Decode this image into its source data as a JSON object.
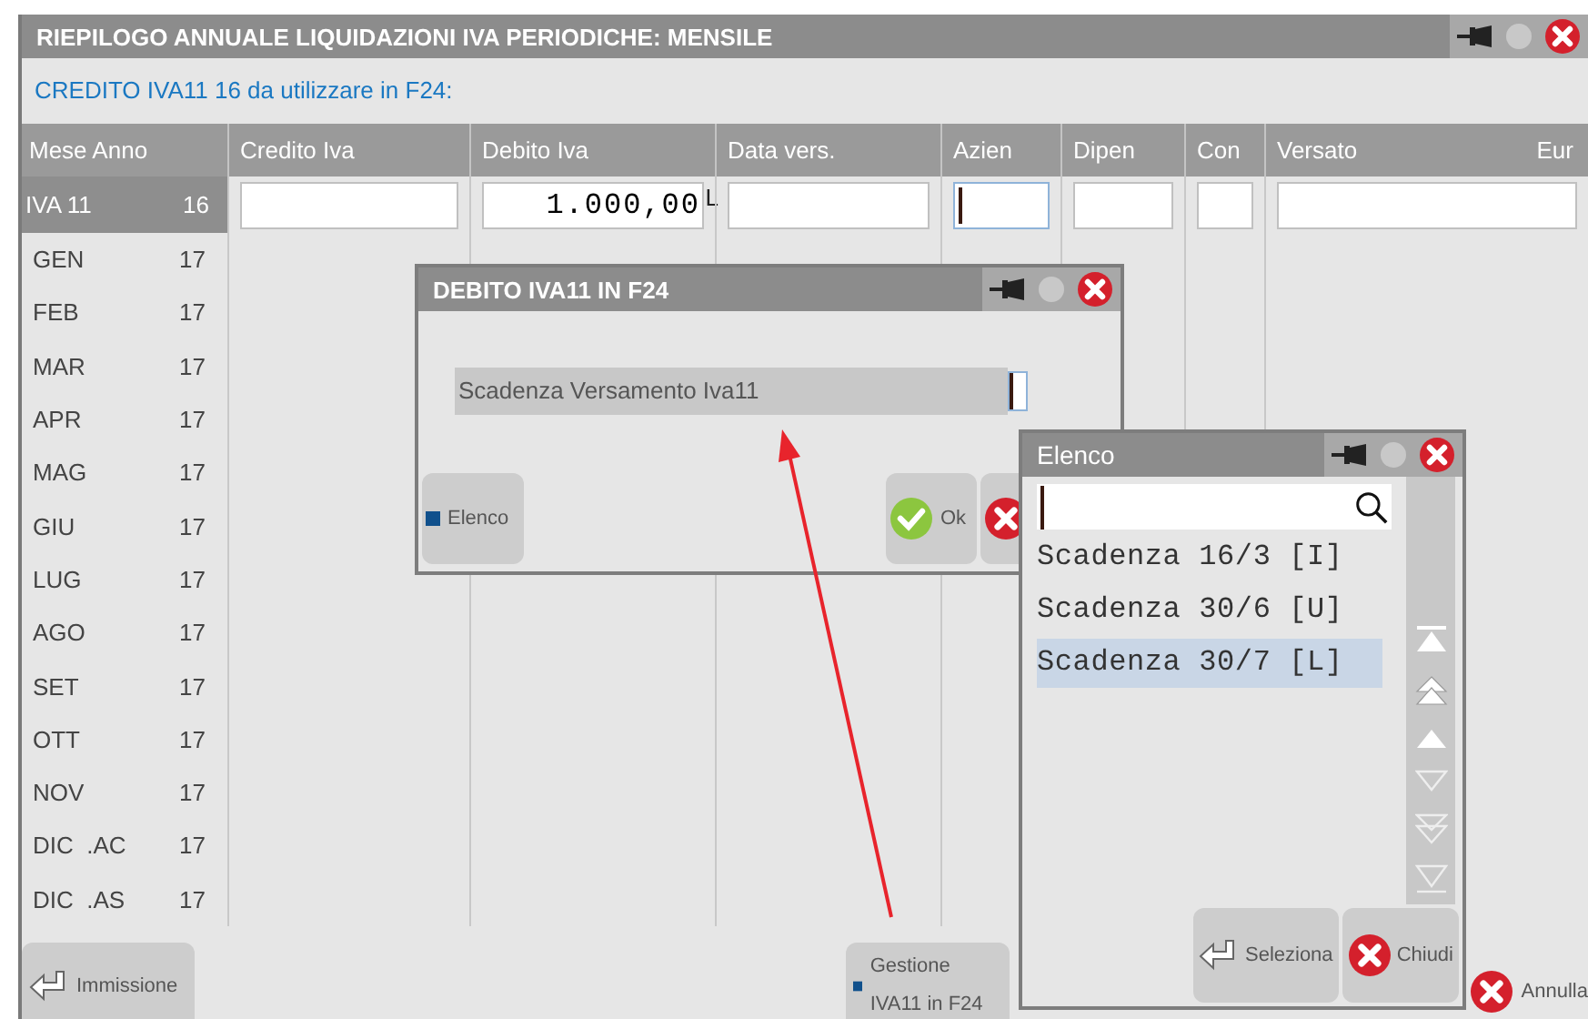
{
  "window": {
    "title": "RIEPILOGO ANNUALE LIQUIDAZIONI IVA PERIODICHE: MENSILE"
  },
  "subtitle": "CREDITO IVA11 16 da utilizzare in F24:",
  "table": {
    "columns": [
      "Mese Anno",
      "Credito Iva",
      "Debito  Iva",
      "Data vers.",
      "Azien",
      "Dipen",
      "Con",
      "Versato"
    ],
    "currency_label": "Eur",
    "entry_row": {
      "month": "IVA 11",
      "year": "16",
      "fields": [
        {
          "focused": false
        },
        {
          "focused": false,
          "value": "1.000,00",
          "suffix": "L"
        },
        {
          "focused": false
        },
        {
          "focused": true
        },
        {
          "focused": false
        },
        {
          "focused": false
        },
        {
          "focused": false
        }
      ]
    },
    "rows": [
      {
        "month": "GEN",
        "year": "17"
      },
      {
        "month": "FEB",
        "year": "17"
      },
      {
        "month": "MAR",
        "year": "17"
      },
      {
        "month": "APR",
        "year": "17"
      },
      {
        "month": "MAG",
        "year": "17"
      },
      {
        "month": "GIU",
        "year": "17"
      },
      {
        "month": "LUG",
        "year": "17"
      },
      {
        "month": "AGO",
        "year": "17"
      },
      {
        "month": "SET",
        "year": "17"
      },
      {
        "month": "OTT",
        "year": "17"
      },
      {
        "month": "NOV",
        "year": "17"
      },
      {
        "month": "DIC  .AC",
        "year": "17"
      },
      {
        "month": "DIC  .AS",
        "year": "17"
      }
    ]
  },
  "buttons": [
    {
      "label": "Immissione",
      "kind": "enter"
    },
    {
      "label": "Gestione IVA11 in F24",
      "kind": "square"
    },
    {
      "label": "Annulla",
      "kind": "cancel"
    }
  ],
  "dialog": {
    "title": "DEBITO IVA11 IN F24",
    "field": {
      "label": "Scadenza Versamento Iva11",
      "focused": true
    },
    "buttons": [
      {
        "label": "Elenco",
        "kind": "square"
      },
      {
        "label": "Ok",
        "kind": "check"
      },
      {
        "kind": "cancel"
      }
    ]
  },
  "list_popup": {
    "title": "Elenco",
    "search": {
      "focused": true
    },
    "items": [
      {
        "label": "Scadenza 16/3 [I]",
        "selected": false
      },
      {
        "label": "Scadenza 30/6 [U]",
        "selected": false
      },
      {
        "label": "Scadenza 30/7 [L]",
        "selected": true
      }
    ],
    "buttons": [
      {
        "label": "Seleziona",
        "kind": "enter"
      },
      {
        "label": "Chiudi",
        "kind": "cancel"
      }
    ]
  }
}
